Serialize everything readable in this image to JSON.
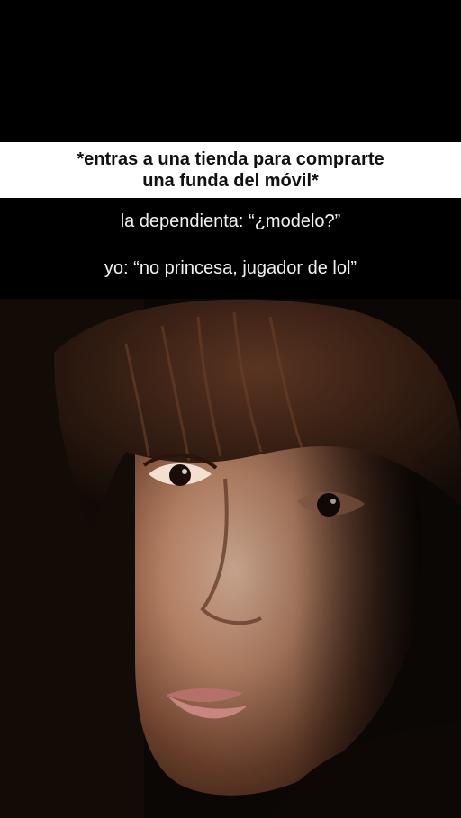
{
  "caption": {
    "line1": "*entras a una tienda para comprarte",
    "line2": "una funda del móvil*"
  },
  "dialog": {
    "line1": "la dependienta: “¿modelo?”",
    "line2": "yo: “no princesa, jugador de lol”"
  },
  "photo": {
    "subject": "close-up portrait of a young man with brown fringe hair in low-key lighting"
  },
  "colors": {
    "background": "#000000",
    "caption_band": "#ffffff",
    "caption_text": "#111111",
    "dialog_text": "#f2f2f2"
  }
}
